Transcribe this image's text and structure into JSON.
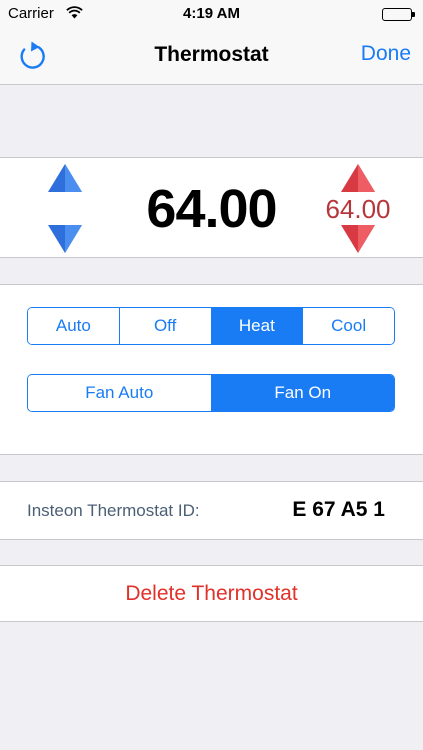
{
  "status_bar": {
    "carrier": "Carrier",
    "time": "4:19 AM"
  },
  "nav": {
    "title": "Thermostat",
    "done_label": "Done",
    "refresh_icon": "refresh-icon"
  },
  "temperature": {
    "current": "64.00",
    "setpoint": "64.00",
    "colors": {
      "cool_arrow": "#2f6fdc",
      "heat_arrow": "#e3464f",
      "setpoint_text": "#b5373b"
    }
  },
  "mode": {
    "options": [
      "Auto",
      "Off",
      "Heat",
      "Cool"
    ],
    "selected": "Heat"
  },
  "fan": {
    "options": [
      "Fan Auto",
      "Fan On"
    ],
    "selected": "Fan On"
  },
  "device": {
    "id_label": "Insteon Thermostat ID:",
    "id_value": "E 67 A5 1"
  },
  "actions": {
    "delete_label": "Delete Thermostat"
  },
  "colors": {
    "accent": "#1a7cf5",
    "destructive": "#e1312a",
    "background": "#efeff4"
  }
}
